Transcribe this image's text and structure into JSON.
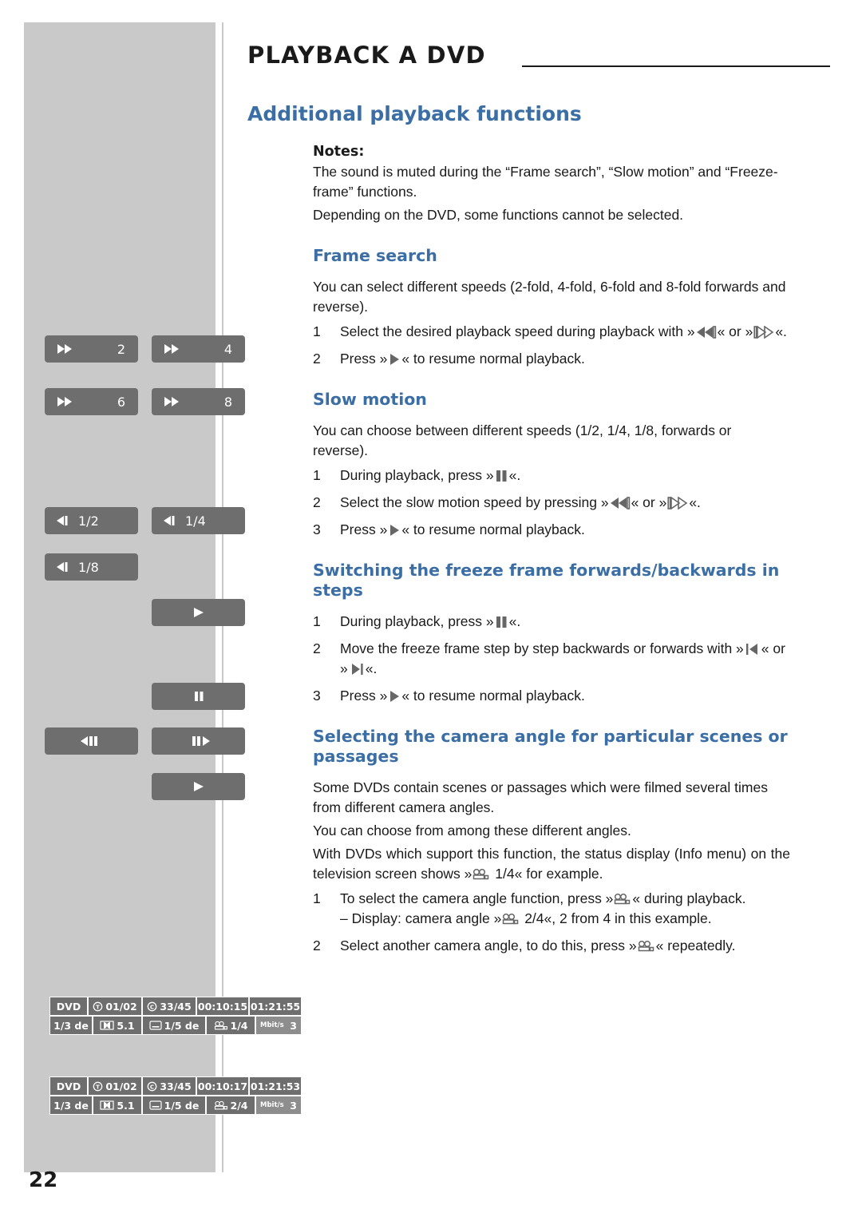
{
  "header": {
    "doc_title": "PLAYBACK A DVD",
    "section_title": "Additional playback functions"
  },
  "notes": {
    "label": "Notes:",
    "lines": [
      "The sound is muted during the “Frame search”, “Slow motion” and “Freeze-frame” functions.",
      "Depending on the DVD, some functions cannot be selected."
    ]
  },
  "sections": [
    {
      "heading": "Frame search",
      "intro": "You can select different speeds (2-fold, 4-fold, 6-fold and 8-fold forwards and reverse).",
      "steps": [
        {
          "num": "1",
          "pre": "Select the desired playback speed during playback with »",
          "mid": "« or »",
          "post": "«."
        },
        {
          "num": "2",
          "pre": "Press »",
          "post": "« to resume normal playback."
        }
      ]
    },
    {
      "heading": "Slow motion",
      "intro": "You can choose between different speeds (1/2, 1/4, 1/8, forwards or reverse).",
      "steps": [
        {
          "num": "1",
          "pre": "During playback, press »",
          "post": "«."
        },
        {
          "num": "2",
          "pre": "Select the slow motion speed by pressing »",
          "mid": "« or »",
          "post": "«."
        },
        {
          "num": "3",
          "pre": "Press »",
          "post": "« to resume normal playback."
        }
      ]
    },
    {
      "heading": "Switching the freeze frame forwards/backwards in steps",
      "steps": [
        {
          "num": "1",
          "pre": "During playback, press »",
          "post": "«."
        },
        {
          "num": "2",
          "pre": "Move the freeze frame step by step backwards or forwards with »",
          "mid": "« or »",
          "post": "«."
        },
        {
          "num": "3",
          "pre": "Press »",
          "post": "« to resume normal playback."
        }
      ]
    },
    {
      "heading": "Selecting the camera angle for particular scenes or passages",
      "paragraphs": [
        "Some DVDs contain scenes or passages which were filmed several times from different camera angles.",
        "You can choose from among these different angles."
      ],
      "para_with_icon": {
        "pre": "With DVDs which support this function, the status display (Info menu) on the television screen shows »",
        "post": "1/4« for example."
      },
      "steps": [
        {
          "num": "1",
          "pre": "To select the camera angle function, press »",
          "post": "« during playback."
        },
        {
          "num": "2",
          "pre": "Select another camera angle, to do this, press »",
          "post": "« repeatedly."
        }
      ],
      "display_note": {
        "pre": "– Display: camera angle »",
        "post": "2/4«, 2 from 4 in this example."
      }
    }
  ],
  "buttons": [
    {
      "name": "ffwd-2x",
      "icon": "fast-forward-icon",
      "label": "2"
    },
    {
      "name": "ffwd-4x",
      "icon": "fast-forward-icon",
      "label": "4"
    },
    {
      "name": "ffwd-6x",
      "icon": "fast-forward-icon",
      "label": "6"
    },
    {
      "name": "ffwd-8x",
      "icon": "fast-forward-icon",
      "label": "8"
    },
    {
      "name": "slow-half",
      "icon": "slow-reverse-icon",
      "label": "1/2"
    },
    {
      "name": "slow-quarter",
      "icon": "slow-reverse-icon",
      "label": "1/4"
    },
    {
      "name": "slow-eighth",
      "icon": "slow-reverse-icon",
      "label": "1/8"
    },
    {
      "name": "play",
      "icon": "play-icon",
      "label": ""
    },
    {
      "name": "pause",
      "icon": "pause-icon",
      "label": ""
    },
    {
      "name": "step-back",
      "icon": "step-backward-icon",
      "label": ""
    },
    {
      "name": "step-forward",
      "icon": "step-forward-icon",
      "label": ""
    },
    {
      "name": "play-2",
      "icon": "play-icon",
      "label": ""
    }
  ],
  "osd": [
    {
      "name": "status-display-angle-1of4",
      "top_row": [
        {
          "text": "DVD",
          "icon": ""
        },
        {
          "text": "01/02",
          "icon": "title-icon"
        },
        {
          "text": "33/45",
          "icon": "chapter-icon"
        },
        {
          "text": "00:10:15",
          "icon": ""
        },
        {
          "text": "01:21:55",
          "icon": ""
        }
      ],
      "bottom_row": [
        {
          "text": "1/3 de",
          "icon": ""
        },
        {
          "text": "5.1",
          "icon": "dolby-icon"
        },
        {
          "text": "1/5 de",
          "icon": "subtitle-icon"
        },
        {
          "text": "1/4",
          "icon": "camera-angle-icon"
        },
        {
          "text": "3",
          "icon": "mbit-icon"
        }
      ]
    },
    {
      "name": "status-display-angle-2of4",
      "top_row": [
        {
          "text": "DVD",
          "icon": ""
        },
        {
          "text": "01/02",
          "icon": "title-icon"
        },
        {
          "text": "33/45",
          "icon": "chapter-icon"
        },
        {
          "text": "00:10:17",
          "icon": ""
        },
        {
          "text": "01:21:53",
          "icon": ""
        }
      ],
      "bottom_row": [
        {
          "text": "1/3 de",
          "icon": ""
        },
        {
          "text": "5.1",
          "icon": "dolby-icon"
        },
        {
          "text": "1/5 de",
          "icon": "subtitle-icon"
        },
        {
          "text": "2/4",
          "icon": "camera-angle-icon"
        },
        {
          "text": "3",
          "icon": "mbit-icon"
        }
      ]
    }
  ],
  "page_number": "22",
  "colors": {
    "accent": "#3b6ea5",
    "panel": "#c9c9c9",
    "button": "#6e6e6e"
  }
}
